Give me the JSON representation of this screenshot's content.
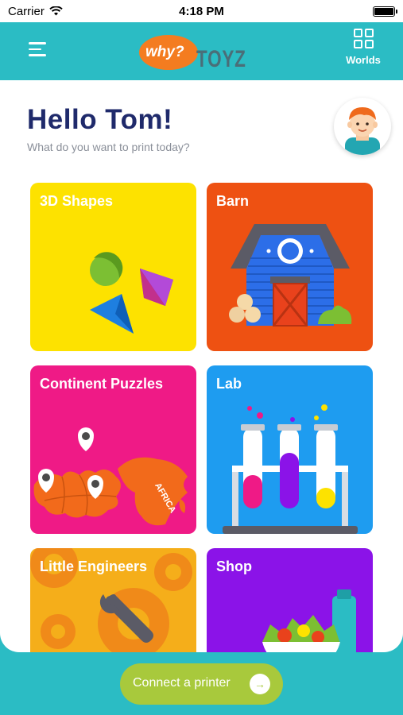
{
  "status_bar": {
    "carrier": "Carrier",
    "time": "4:18 PM"
  },
  "nav": {
    "logo_why": "why?",
    "logo_toyz": "TOYZ",
    "worlds_label": "Worlds"
  },
  "header": {
    "greeting": "Hello Tom!",
    "subtitle": "What do you want to print today?"
  },
  "categories": [
    {
      "title": "3D Shapes"
    },
    {
      "title": "Barn"
    },
    {
      "title": "Continent Puzzles"
    },
    {
      "title": "Lab"
    },
    {
      "title": "Little Engineers"
    },
    {
      "title": "Shop"
    }
  ],
  "puzzle_label": "AFRICA",
  "connect_button": {
    "label": "Connect a printer"
  },
  "colors": {
    "brand": "#2bbcc4",
    "heading": "#1f2a6b",
    "shapes": "#fde200",
    "barn": "#ee5112",
    "puzzles": "#ef1a86",
    "lab": "#1e9cf0",
    "engineers": "#f5ae1a",
    "shop": "#8b13e8",
    "connect": "#a8c93c"
  },
  "icons": [
    "wifi-icon",
    "battery-icon",
    "menu-icon",
    "worlds-icon",
    "arrow-right-icon",
    "avatar"
  ]
}
